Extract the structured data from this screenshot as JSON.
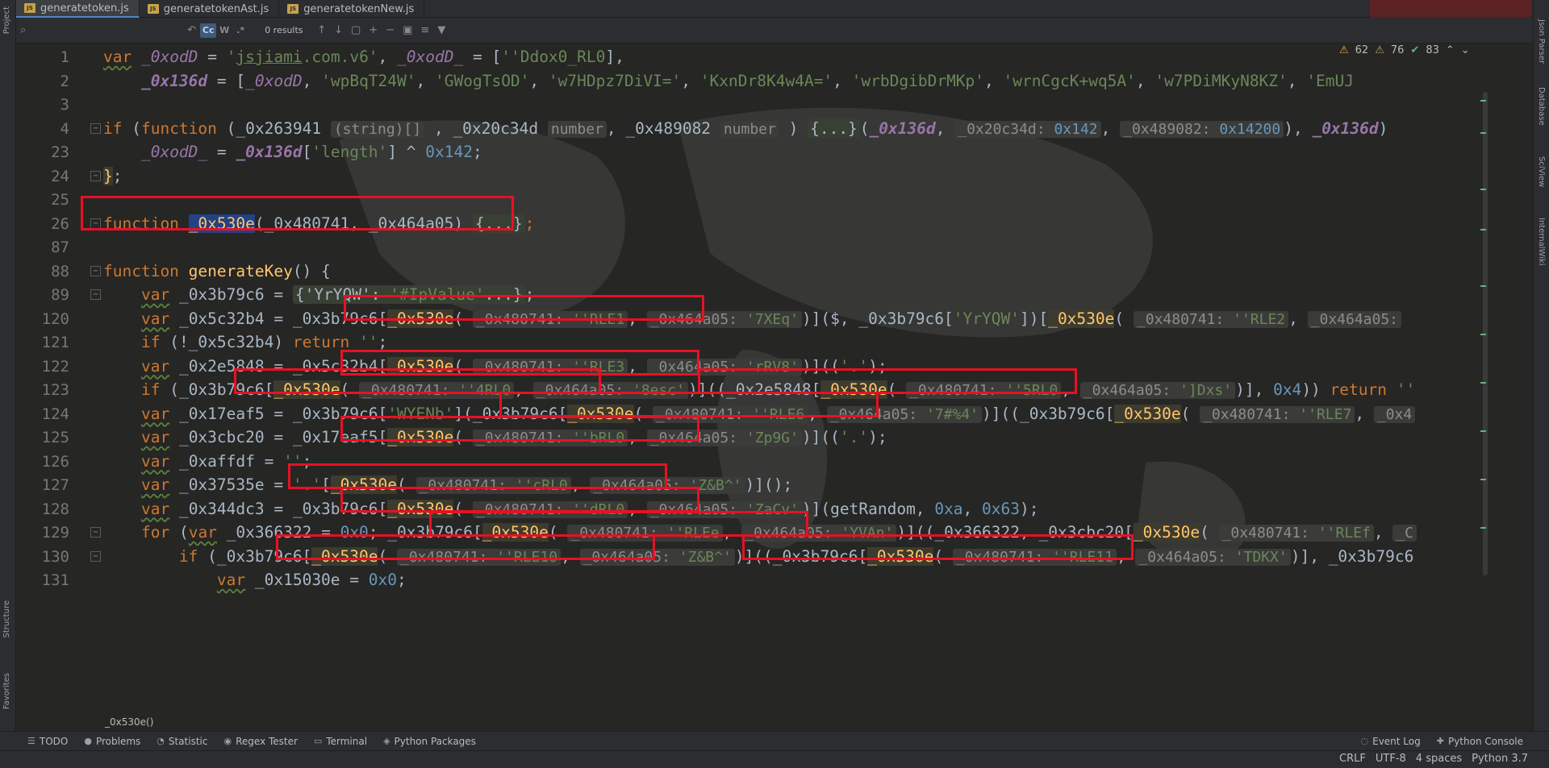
{
  "tabs": [
    {
      "label": "generatetoken.js",
      "active": true
    },
    {
      "label": "generatetokenAst.js",
      "active": false
    },
    {
      "label": "generatetokenNew.js",
      "active": false
    }
  ],
  "search": {
    "results": "0 results",
    "toggles": {
      "case": "Cc",
      "word": "W",
      "regex": ".*"
    }
  },
  "inspections": {
    "warnings": "62",
    "weak_warnings": "76",
    "ok": "83"
  },
  "left_strip": {
    "project": "Project",
    "structure": "Structure",
    "favorites": "Favorites"
  },
  "right_strip": {
    "json_parser": "Json Parser",
    "database": "Database",
    "sciview": "SciView",
    "wiki": "InternalWiki"
  },
  "lines": [
    {
      "n": "1"
    },
    {
      "n": "2"
    },
    {
      "n": "3"
    },
    {
      "n": "4"
    },
    {
      "n": "23"
    },
    {
      "n": "24"
    },
    {
      "n": "25"
    },
    {
      "n": "26"
    },
    {
      "n": "87"
    },
    {
      "n": "88"
    },
    {
      "n": "89"
    },
    {
      "n": "120"
    },
    {
      "n": "121"
    },
    {
      "n": "122"
    },
    {
      "n": "123"
    },
    {
      "n": "124"
    },
    {
      "n": "125"
    },
    {
      "n": "126"
    },
    {
      "n": "127"
    },
    {
      "n": "128"
    },
    {
      "n": "129"
    },
    {
      "n": "130"
    },
    {
      "n": "131"
    }
  ],
  "breadcrumb": "_0x530e()",
  "tool_windows": [
    "TODO",
    "Problems",
    "Statistic",
    "Regex Tester",
    "Terminal",
    "Python Packages"
  ],
  "tool_windows_right": [
    "Event Log",
    "Python Console"
  ],
  "status": {
    "line_sep": "CRLF",
    "encoding": "UTF-8",
    "indent": "4 spaces",
    "interpreter": "Python 3.7"
  }
}
